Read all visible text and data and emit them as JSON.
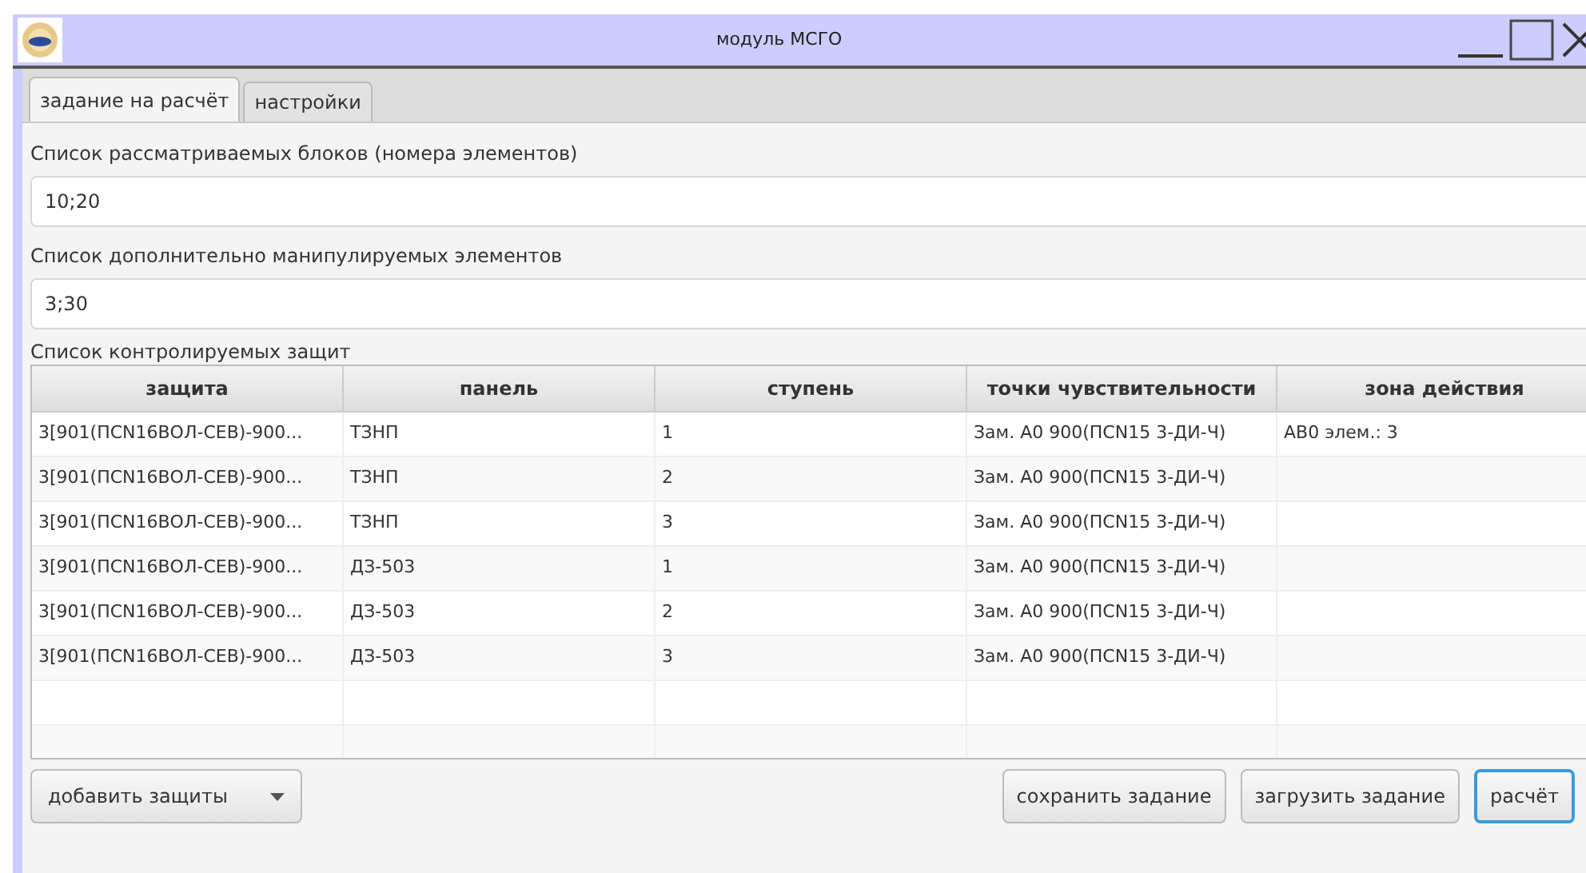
{
  "window": {
    "title": "модуль МСГО"
  },
  "tabs": [
    {
      "label": "задание на расчёт",
      "selected": true
    },
    {
      "label": "настройки",
      "selected": false
    }
  ],
  "blocks_field": {
    "label": "Список рассматриваемых блоков (номера элементов)",
    "value": "10;20"
  },
  "elements_field": {
    "label": "Список дополнительно манипулируемых элементов",
    "value": "3;30"
  },
  "table": {
    "label": "Список контролируемых защит",
    "columns": [
      "защита",
      "панель",
      "ступень",
      "точки чувствительности",
      "зона действия"
    ],
    "rows": [
      [
        "3[901(ПСN16ВОЛ-СЕВ)-900...",
        "ТЗНП",
        "1",
        "Зам. А0 900(ПСN15 3-ДИ-Ч)",
        "АВ0 элем.: 3"
      ],
      [
        "3[901(ПСN16ВОЛ-СЕВ)-900...",
        "ТЗНП",
        "2",
        "Зам. А0 900(ПСN15 3-ДИ-Ч)",
        ""
      ],
      [
        "3[901(ПСN16ВОЛ-СЕВ)-900...",
        "ТЗНП",
        "3",
        "Зам. А0 900(ПСN15 3-ДИ-Ч)",
        ""
      ],
      [
        "3[901(ПСN16ВОЛ-СЕВ)-900...",
        "ДЗ-503",
        "1",
        "Зам. А0 900(ПСN15 3-ДИ-Ч)",
        ""
      ],
      [
        "3[901(ПСN16ВОЛ-СЕВ)-900...",
        "ДЗ-503",
        "2",
        "Зам. А0 900(ПСN15 3-ДИ-Ч)",
        ""
      ],
      [
        "3[901(ПСN16ВОЛ-СЕВ)-900...",
        "ДЗ-503",
        "3",
        "Зам. А0 900(ПСN15 3-ДИ-Ч)",
        ""
      ]
    ]
  },
  "add_dropdown": {
    "label": "добавить защиты"
  },
  "buttons": [
    {
      "label": "сохранить задание",
      "focused": false
    },
    {
      "label": "загрузить задание",
      "focused": false
    },
    {
      "label": "расчёт",
      "focused": true
    }
  ]
}
